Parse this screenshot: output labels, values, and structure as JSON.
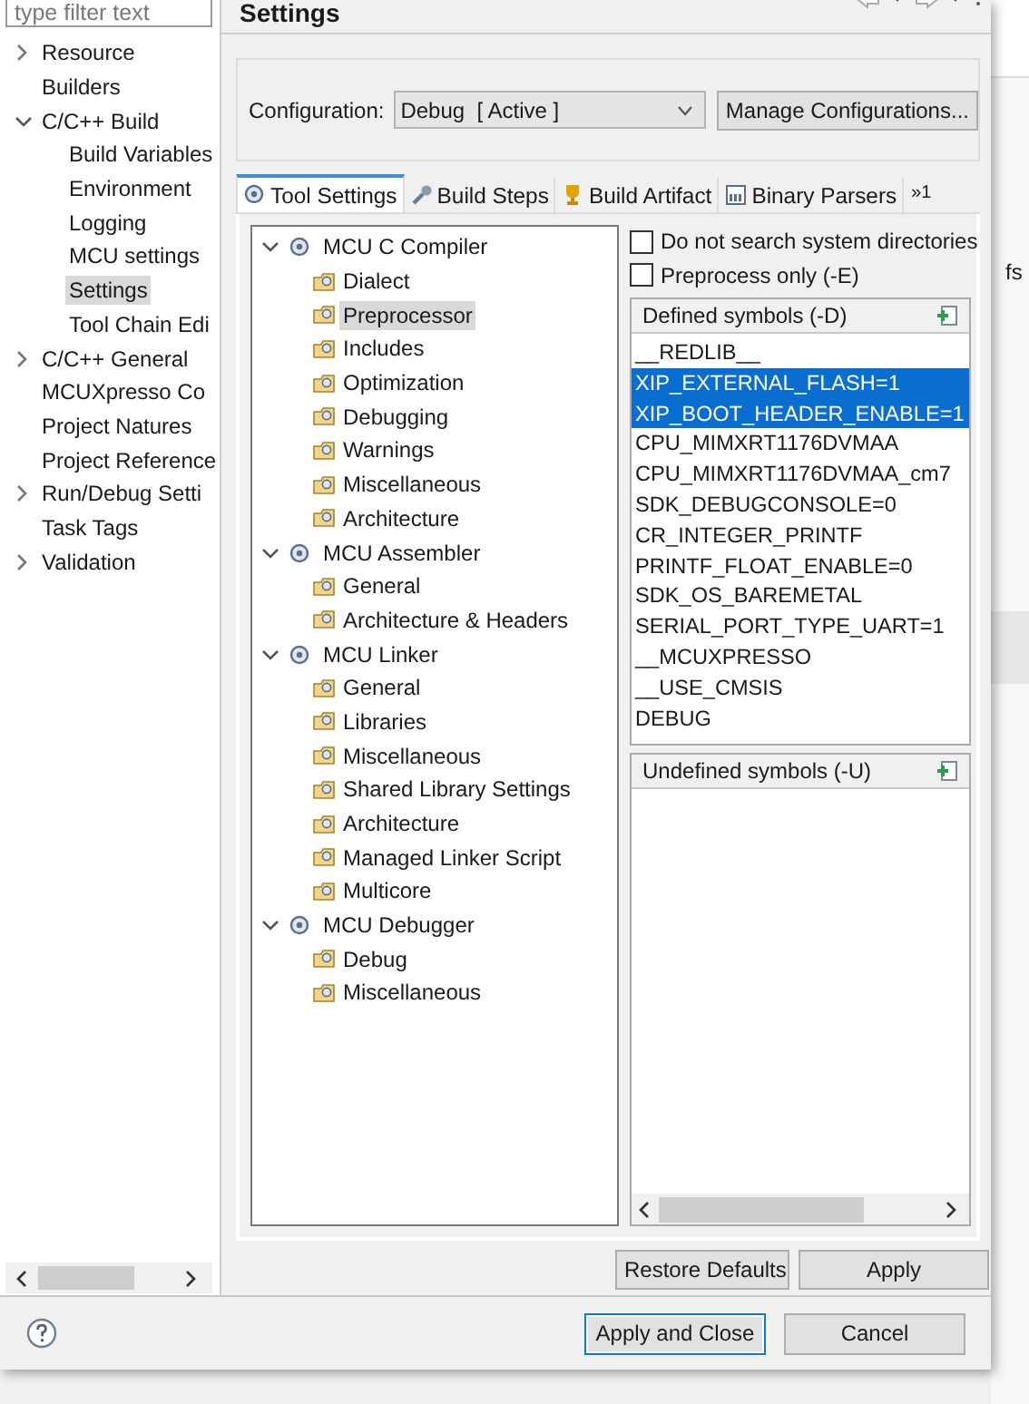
{
  "filter": {
    "placeholder": "type filter text"
  },
  "nav": [
    {
      "label": "Resource",
      "kind": "group",
      "expanded": false,
      "selected": false
    },
    {
      "label": "Builders",
      "kind": "item",
      "selected": false
    },
    {
      "label": "C/C++ Build",
      "kind": "group",
      "expanded": true,
      "selected": false,
      "children": [
        {
          "label": "Build Variables",
          "selected": false
        },
        {
          "label": "Environment",
          "selected": false
        },
        {
          "label": "Logging",
          "selected": false
        },
        {
          "label": "MCU settings",
          "selected": false
        },
        {
          "label": "Settings",
          "selected": true
        },
        {
          "label": "Tool Chain Edi",
          "selected": false
        }
      ]
    },
    {
      "label": "C/C++ General",
      "kind": "group",
      "expanded": false,
      "selected": false
    },
    {
      "label": "MCUXpresso Co",
      "kind": "item",
      "selected": false
    },
    {
      "label": "Project Natures",
      "kind": "item",
      "selected": false
    },
    {
      "label": "Project Reference",
      "kind": "item",
      "selected": false
    },
    {
      "label": "Run/Debug Setti",
      "kind": "group",
      "expanded": false,
      "selected": false
    },
    {
      "label": "Task Tags",
      "kind": "item",
      "selected": false
    },
    {
      "label": "Validation",
      "kind": "group",
      "expanded": false,
      "selected": false
    }
  ],
  "page": {
    "title": "Settings"
  },
  "configuration": {
    "label": "Configuration:",
    "value": "Debug  [ Active ]",
    "manage_button": "Manage Configurations..."
  },
  "tabs": [
    {
      "label": "Tool Settings",
      "selected": true
    },
    {
      "label": "Build Steps",
      "selected": false
    },
    {
      "label": "Build Artifact",
      "selected": false
    },
    {
      "label": "Binary Parsers",
      "selected": false
    }
  ],
  "tabs_overflow": "»1",
  "tool_tree": [
    {
      "label": "MCU C Compiler",
      "expanded": true,
      "children": [
        {
          "label": "Dialect",
          "selected": false
        },
        {
          "label": "Preprocessor",
          "selected": true
        },
        {
          "label": "Includes",
          "selected": false
        },
        {
          "label": "Optimization",
          "selected": false
        },
        {
          "label": "Debugging",
          "selected": false
        },
        {
          "label": "Warnings",
          "selected": false
        },
        {
          "label": "Miscellaneous",
          "selected": false
        },
        {
          "label": "Architecture",
          "selected": false
        }
      ]
    },
    {
      "label": "MCU Assembler",
      "expanded": true,
      "children": [
        {
          "label": "General",
          "selected": false
        },
        {
          "label": "Architecture & Headers",
          "selected": false
        }
      ]
    },
    {
      "label": "MCU Linker",
      "expanded": true,
      "children": [
        {
          "label": "General",
          "selected": false
        },
        {
          "label": "Libraries",
          "selected": false
        },
        {
          "label": "Miscellaneous",
          "selected": false
        },
        {
          "label": "Shared Library Settings",
          "selected": false
        },
        {
          "label": "Architecture",
          "selected": false
        },
        {
          "label": "Managed Linker Script",
          "selected": false
        },
        {
          "label": "Multicore",
          "selected": false
        }
      ]
    },
    {
      "label": "MCU Debugger",
      "expanded": true,
      "children": [
        {
          "label": "Debug",
          "selected": false
        },
        {
          "label": "Miscellaneous",
          "selected": false
        }
      ]
    }
  ],
  "options": [
    {
      "label": "Do not search system directories",
      "checked": false
    },
    {
      "label": "Preprocess only (-E)",
      "checked": false
    }
  ],
  "defined_symbols": {
    "title": "Defined symbols (-D)",
    "items": [
      {
        "text": "__REDLIB__",
        "selected": false
      },
      {
        "text": "XIP_EXTERNAL_FLASH=1",
        "selected": true
      },
      {
        "text": "XIP_BOOT_HEADER_ENABLE=1",
        "selected": true
      },
      {
        "text": "CPU_MIMXRT1176DVMAA",
        "selected": false
      },
      {
        "text": "CPU_MIMXRT1176DVMAA_cm7",
        "selected": false
      },
      {
        "text": "SDK_DEBUGCONSOLE=0",
        "selected": false
      },
      {
        "text": "CR_INTEGER_PRINTF",
        "selected": false
      },
      {
        "text": "PRINTF_FLOAT_ENABLE=0",
        "selected": false
      },
      {
        "text": "SDK_OS_BAREMETAL",
        "selected": false
      },
      {
        "text": "SERIAL_PORT_TYPE_UART=1",
        "selected": false
      },
      {
        "text": "__MCUXPRESSO",
        "selected": false
      },
      {
        "text": "__USE_CMSIS",
        "selected": false
      },
      {
        "text": "DEBUG",
        "selected": false
      }
    ]
  },
  "undefined_symbols": {
    "title": "Undefined symbols (-U)"
  },
  "page_buttons": [
    "Restore Defaults",
    "Apply"
  ],
  "dialog_buttons": [
    {
      "label": "Apply and Close",
      "default": true
    },
    {
      "label": "Cancel",
      "default": false
    }
  ],
  "background_text": "fs"
}
